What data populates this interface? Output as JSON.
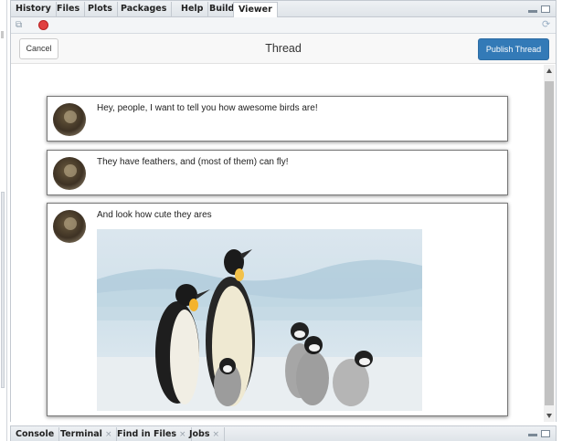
{
  "tabs": [
    {
      "label": "History"
    },
    {
      "label": "Files"
    },
    {
      "label": "Plots"
    },
    {
      "label": "Packages"
    },
    {
      "label": "Help"
    },
    {
      "label": "Build"
    },
    {
      "label": "Viewer",
      "active": true
    }
  ],
  "toolbar": {
    "icons": [
      "popout-icon",
      "stop-icon",
      "refresh-icon"
    ]
  },
  "thread": {
    "cancel_label": "Cancel",
    "title": "Thread",
    "publish_label": "Publish Thread",
    "posts": [
      {
        "text": "Hey, people, I want to tell you how awesome birds are!",
        "image": false
      },
      {
        "text": "They have feathers, and (most of them) can fly!",
        "image": false
      },
      {
        "text": "And look how cute they ares",
        "image": true
      }
    ]
  },
  "bottom_tabs": [
    {
      "label": "Console",
      "closable": false
    },
    {
      "label": "Terminal",
      "closable": true
    },
    {
      "label": "Find in Files",
      "closable": true
    },
    {
      "label": "Jobs",
      "closable": true
    }
  ],
  "colors": {
    "publish_button": "#337ab7",
    "stop_icon": "#e04040"
  }
}
